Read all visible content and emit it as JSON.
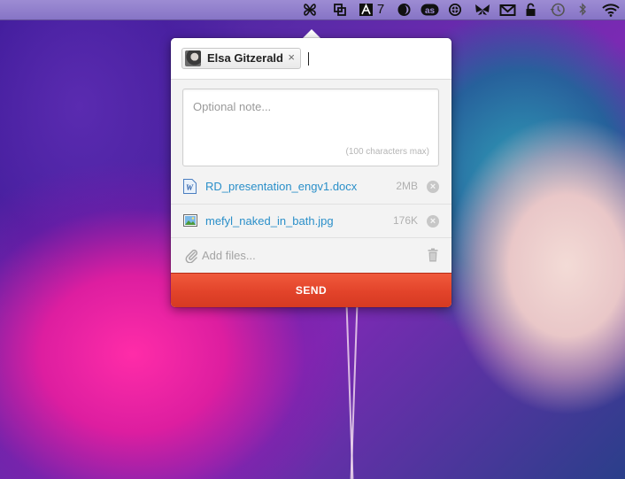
{
  "menubar": {
    "icons": [
      {
        "name": "propeller-icon",
        "glyph": "⁂"
      },
      {
        "name": "screenshot-icon",
        "glyph": "⧉"
      },
      {
        "name": "adobe-icon",
        "glyph": "A"
      },
      {
        "name": "half-moon-icon",
        "glyph": "◐"
      },
      {
        "name": "lastfm-icon",
        "glyph": "as"
      },
      {
        "name": "globe-icon",
        "glyph": "⊕"
      },
      {
        "name": "butterfly-icon",
        "glyph": "⋈"
      },
      {
        "name": "mail-icon",
        "glyph": "✉"
      },
      {
        "name": "lock-icon",
        "glyph": "🔒"
      },
      {
        "name": "time-machine-icon",
        "glyph": "◷"
      },
      {
        "name": "bluetooth-icon",
        "glyph": "ᛒ"
      },
      {
        "name": "wifi-icon",
        "glyph": "◠"
      }
    ],
    "adobe_badge": "7"
  },
  "recipient": {
    "name": "Elsa Gitzerald",
    "remove_glyph": "×"
  },
  "note": {
    "placeholder": "Optional note...",
    "limit_hint": "(100 characters max)"
  },
  "files": [
    {
      "name": "RD_presentation_engv1.docx",
      "size": "2MB",
      "icon": "word-document-icon"
    },
    {
      "name": "mefyl_naked_in_bath.jpg",
      "size": "176K",
      "icon": "image-file-icon"
    }
  ],
  "add_files": {
    "label": "Add files..."
  },
  "send_button": {
    "label": "SEND"
  },
  "colors": {
    "accent": "#e2432a",
    "link": "#2a8fc9"
  }
}
